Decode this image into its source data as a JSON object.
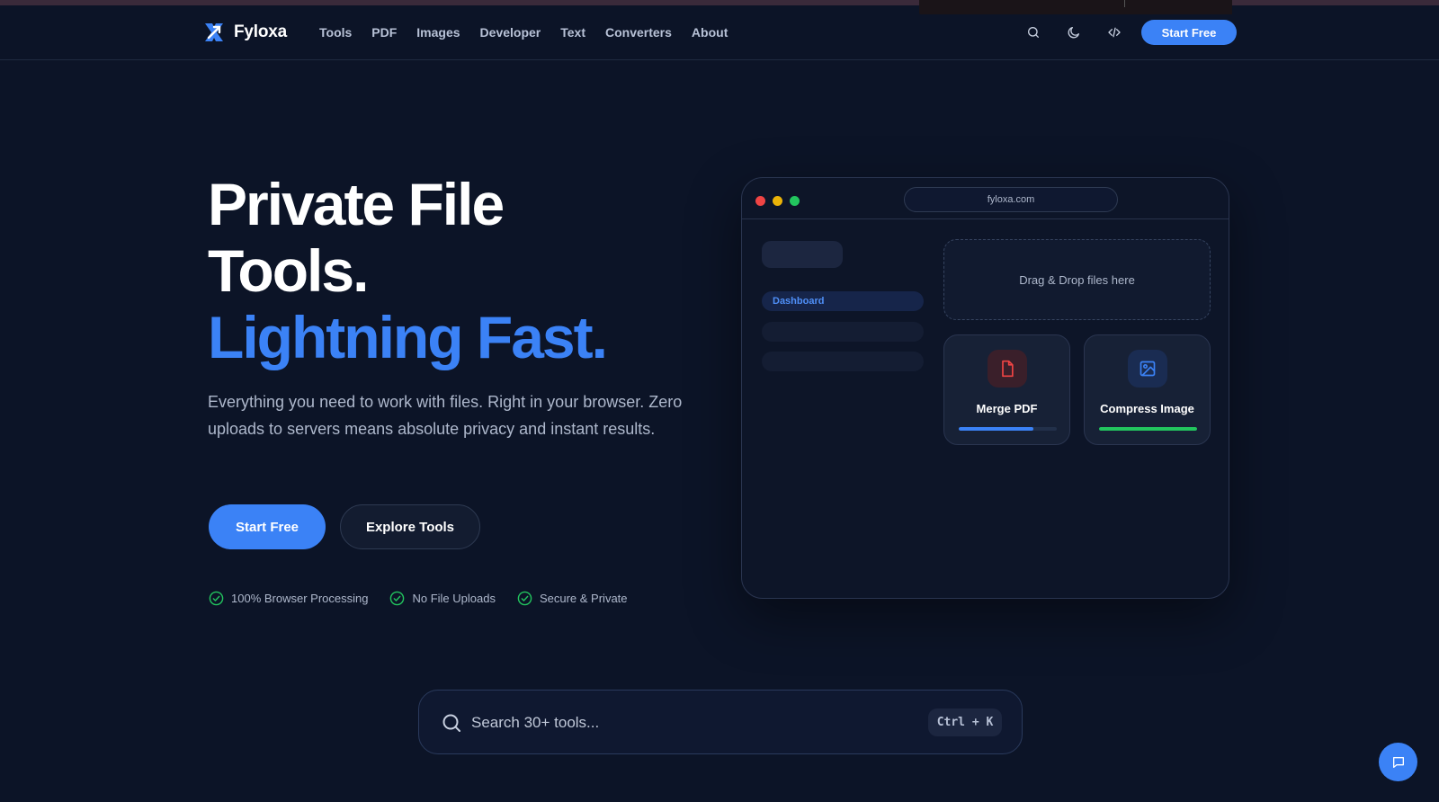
{
  "brand": {
    "name": "Fyloxa",
    "accent": "#3b82f6"
  },
  "nav": {
    "items": [
      {
        "label": "Tools"
      },
      {
        "label": "PDF"
      },
      {
        "label": "Images"
      },
      {
        "label": "Developer"
      },
      {
        "label": "Text"
      },
      {
        "label": "Converters"
      },
      {
        "label": "About"
      }
    ],
    "icons": [
      "search-icon",
      "moon-icon",
      "code-icon"
    ],
    "cta": "Start Free"
  },
  "hero": {
    "title_line1": "Private File",
    "title_line2": "Tools.",
    "title_accent": "Lightning Fast.",
    "description": "Everything you need to work with files. Right in your browser. Zero uploads to servers means absolute privacy and instant results.",
    "primary_button": "Start Free",
    "secondary_button": "Explore Tools",
    "features": [
      {
        "label": "100% Browser Processing"
      },
      {
        "label": "No File Uploads"
      },
      {
        "label": "Secure & Private"
      }
    ],
    "feature_color": "#22c55e"
  },
  "mockup": {
    "url": "fyloxa.com",
    "sidebar_active": "Dashboard",
    "dropzone": "Drag & Drop files here",
    "cards": [
      {
        "label": "Merge PDF",
        "icon": "file-icon",
        "progress": 0.76,
        "color": "#3b82f6",
        "icon_color": "#ef4444"
      },
      {
        "label": "Compress Image",
        "icon": "image-icon",
        "progress": 1.0,
        "color": "#22c55e",
        "icon_color": "#3b82f6"
      }
    ],
    "window_dots": [
      "#ef4444",
      "#eab308",
      "#22c55e"
    ]
  },
  "search": {
    "placeholder": "Search 30+ tools...",
    "shortcut": "Ctrl + K"
  }
}
